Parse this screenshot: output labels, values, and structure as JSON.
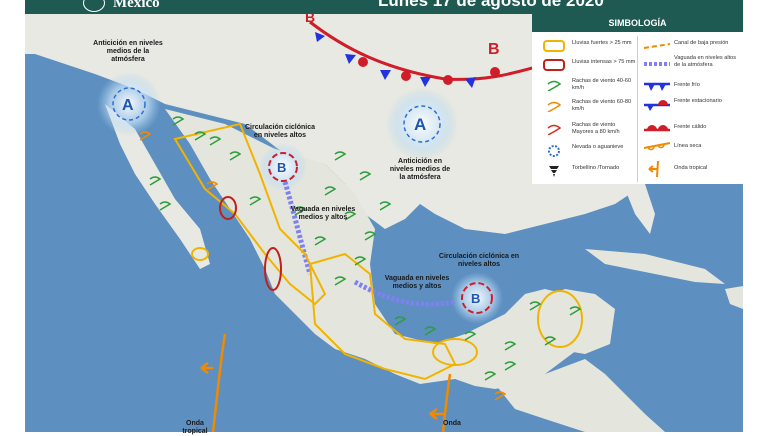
{
  "header": {
    "country": "México",
    "date": "Lunes 17 de agosto de 2020"
  },
  "legend": {
    "title": "SIMBOLOGÍA",
    "items": [
      {
        "key": "lluvias-fuertes",
        "label": "Lluvias fuertes > 25 mm",
        "color": "#f0b400"
      },
      {
        "key": "lluvias-intensas",
        "label": "Lluvias intensas > 75 mm",
        "color": "#c0201a"
      },
      {
        "key": "rachas-40-60",
        "label": "Rachas de viento 40-60 km/h",
        "color": "#2e9e3a"
      },
      {
        "key": "rachas-60-80",
        "label": "Rachas de viento 60-80 km/h",
        "color": "#f08a00"
      },
      {
        "key": "rachas-80",
        "label": "Rachas de viento Mayores a 80 km/h",
        "color": "#d03020"
      },
      {
        "key": "nevada",
        "label": "Nevada o aguanieve",
        "color": "#2f6fd0"
      },
      {
        "key": "torbellino",
        "label": "Torbellino /Tornado",
        "color": "#222222"
      },
      {
        "key": "canal",
        "label": "Canal de baja presión",
        "color": "#f08a00"
      },
      {
        "key": "vaguada",
        "label": "Vaguada en niveles altos de la atmósfera",
        "color": "#7f7ff0"
      },
      {
        "key": "frente-frio",
        "label": "Frente frío",
        "color": "#2233dd"
      },
      {
        "key": "frente-estacionario",
        "label": "Frente estacionario",
        "color": "#2233dd"
      },
      {
        "key": "frente-calido",
        "label": "Frente cálido",
        "color": "#d01d2a"
      },
      {
        "key": "linea-seca",
        "label": "Línea seca",
        "color": "#f08a00"
      },
      {
        "key": "onda-tropical",
        "label": "Onda tropical",
        "color": "#f08a00"
      }
    ]
  },
  "map": {
    "labels": {
      "anticiclon_nw": "Anticición en niveles medios de la atmósfera",
      "anticiclon_gulf": "Anticición en niveles medios de la atmósfera",
      "circulacion_north": "Circulación ciclónica en niveles altos",
      "circulacion_se": "Circulación ciclónica en niveles altos",
      "vaguada_1": "Vaguada en niveles medios y altos",
      "vaguada_2": "Vaguada en niveles medios y altos",
      "onda_1": "Onda tropical",
      "onda_2": "Onda"
    },
    "pressure_letters": {
      "high": "A",
      "low": "B"
    },
    "colors": {
      "ocean": "#5d8fc0",
      "land": "#e7e9e2",
      "header": "#1e5a52",
      "rain_strong": "#f0b400",
      "rain_intense": "#c0201a",
      "wind": "#2e9e3a",
      "trough": "#8080f0",
      "cold_front": "#2233dd",
      "warm_front": "#d01d2a",
      "tropical_wave": "#f08a00"
    }
  }
}
